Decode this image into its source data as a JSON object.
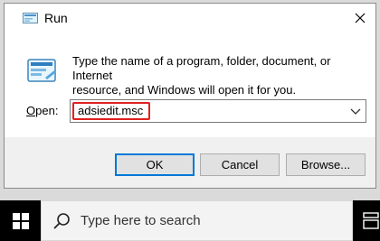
{
  "dialog": {
    "title": "Run",
    "description_line1": "Type the name of a program, folder, document, or Internet",
    "description_line2": "resource, and Windows will open it for you.",
    "open_label_underlined": "O",
    "open_label_rest": "pen:",
    "open_value": "adsiedit.msc",
    "buttons": {
      "ok": "OK",
      "cancel": "Cancel",
      "browse": "Browse..."
    }
  },
  "taskbar": {
    "search_placeholder": "Type here to search"
  },
  "colors": {
    "dialog_bg": "#f0f0f0",
    "content_bg": "#ffffff",
    "highlight_border": "#e02020",
    "ok_border": "#0078d7",
    "taskbar_bg": "#000000",
    "search_bg": "#f3f3f3"
  },
  "icons": {
    "title_icon": "run-app-icon",
    "dialog_icon": "run-app-icon",
    "close": "close-icon",
    "dropdown": "chevron-down-icon",
    "start": "windows-logo-icon",
    "search": "search-icon",
    "task_view": "task-view-icon"
  }
}
